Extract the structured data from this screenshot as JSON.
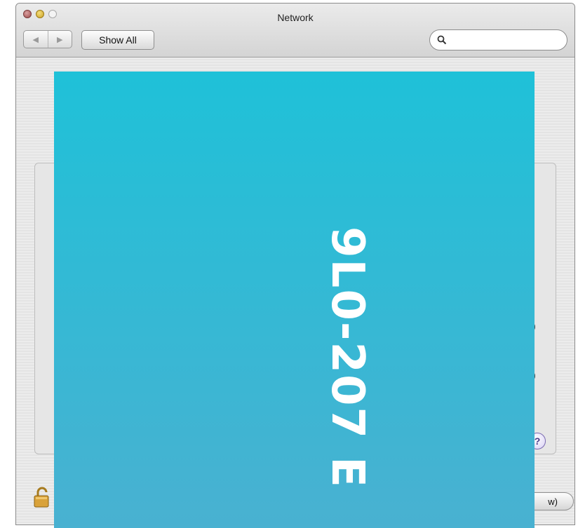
{
  "window": {
    "title": "Network"
  },
  "toolbar": {
    "back_glyph": "◀",
    "forward_glyph": "▶",
    "show_all_label": "Show All",
    "search_placeholder": ""
  },
  "panel": {
    "edge_controls": [
      ")",
      ")",
      ")"
    ],
    "help_label": "?"
  },
  "footer": {
    "button_label": "w)"
  },
  "overlay": {
    "text": "9L0-207 E"
  },
  "colors": {
    "overlay_top": "#1fc1d8",
    "overlay_bottom": "#49b1d1",
    "window_bg": "#e9e9e9",
    "help_accent": "#7a6ab0"
  },
  "icons": {
    "close": "close-icon",
    "minimize": "minimize-icon",
    "zoom": "zoom-icon",
    "back": "back-arrow-icon",
    "forward": "forward-arrow-icon",
    "search": "search-icon",
    "lock": "lock-icon",
    "help": "help-icon"
  }
}
